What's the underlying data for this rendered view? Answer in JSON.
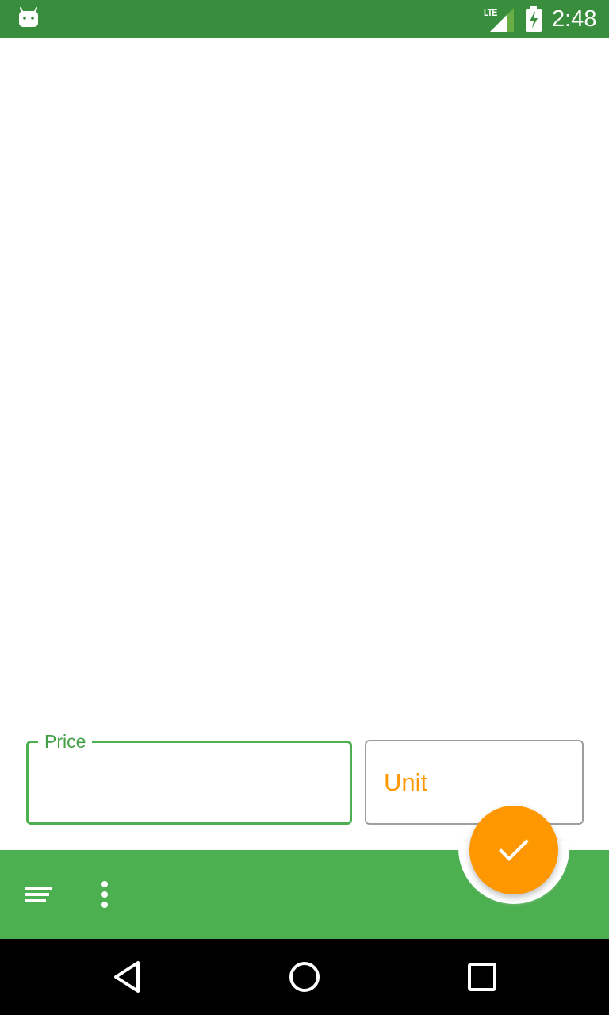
{
  "status_bar": {
    "time": "2:48",
    "network": "LTE",
    "icons": [
      "android-debug-icon",
      "signal-icon",
      "battery-charging-icon"
    ],
    "background_color": "#388E3C"
  },
  "form": {
    "price": {
      "label": "Price",
      "value": "",
      "focused": true,
      "accent_color": "#4CAF50"
    },
    "unit": {
      "label": "Unit",
      "value": "",
      "label_color": "#FF9800"
    }
  },
  "bottom_bar": {
    "background_color": "#4CAF50",
    "navigation_icon": "menu-icon",
    "overflow_icon": "more-vert-icon",
    "fab": {
      "icon": "check-icon",
      "color": "#FF9800"
    }
  },
  "nav_bar": {
    "icons": [
      "back-icon",
      "home-icon",
      "recents-icon"
    ]
  }
}
